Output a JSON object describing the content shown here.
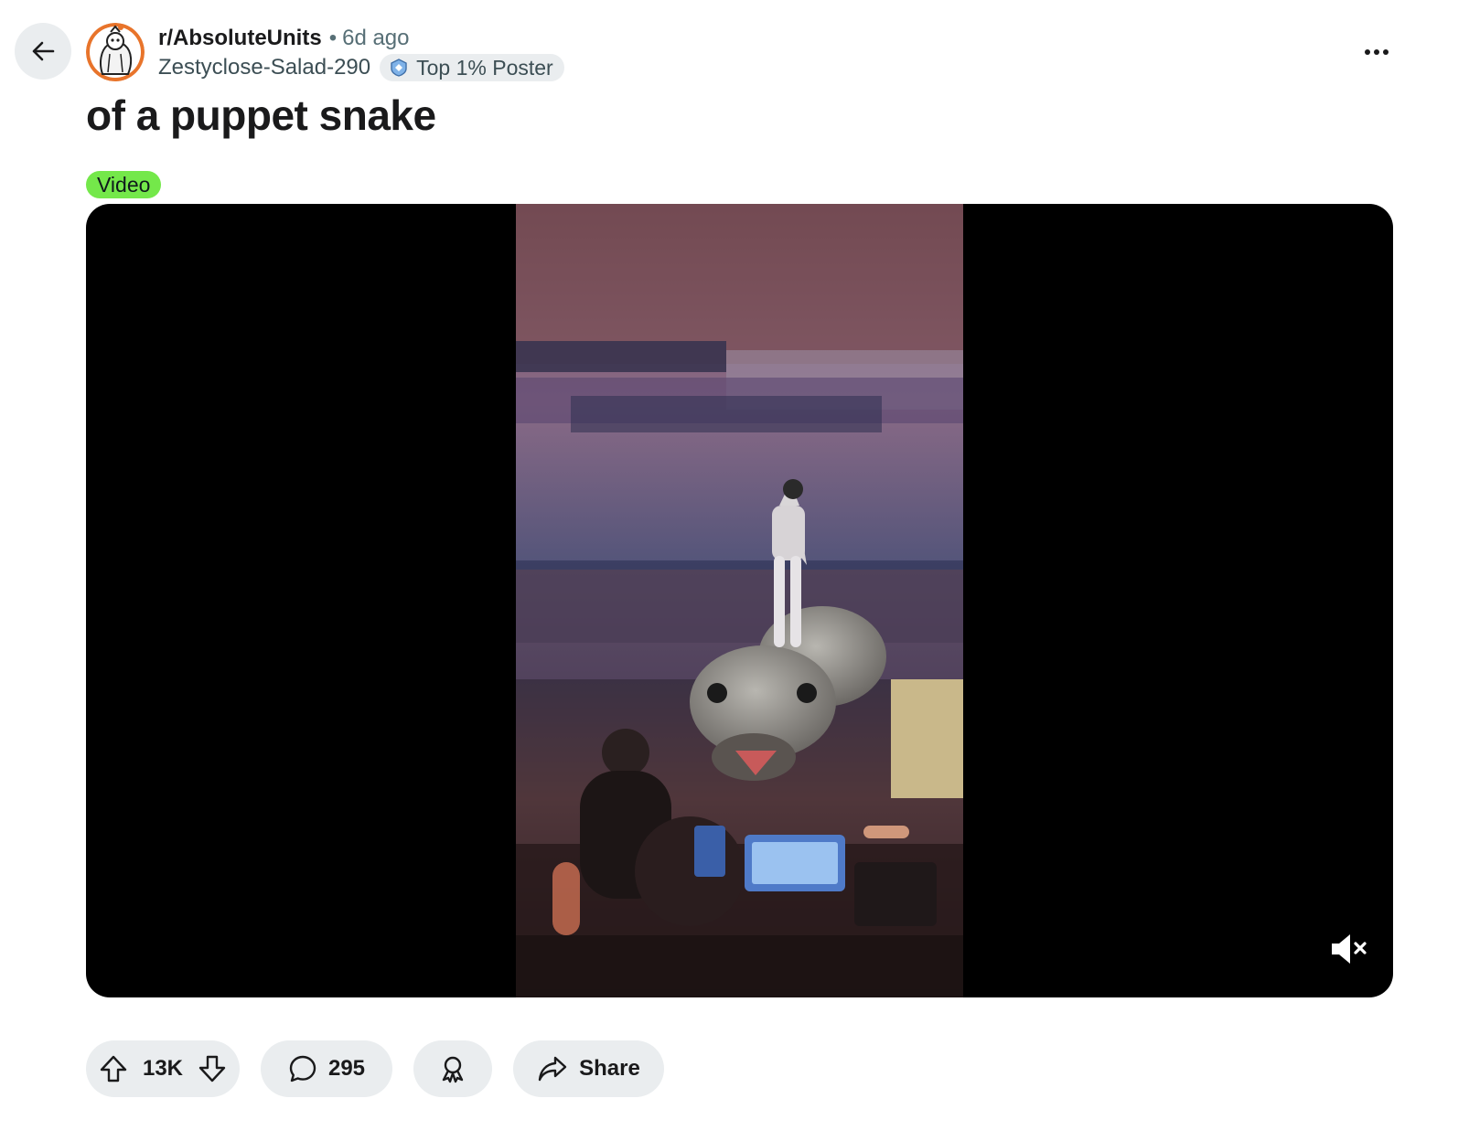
{
  "header": {
    "subreddit": "r/AbsoluteUnits",
    "separator": "•",
    "time": "6d ago",
    "username": "Zestyclose-Salad-290",
    "user_flair": "Top 1% Poster"
  },
  "post": {
    "title": "of a puppet snake",
    "flair": "Video",
    "flair_color": "#74e84a"
  },
  "actions": {
    "votes": "13K",
    "comments": "295",
    "share_label": "Share"
  },
  "icons": {
    "back": "back-arrow-icon",
    "more": "more-options-icon",
    "upvote": "upvote-icon",
    "downvote": "downvote-icon",
    "comment": "comment-icon",
    "award": "award-icon",
    "share": "share-icon",
    "mute": "muted-speaker-icon"
  }
}
